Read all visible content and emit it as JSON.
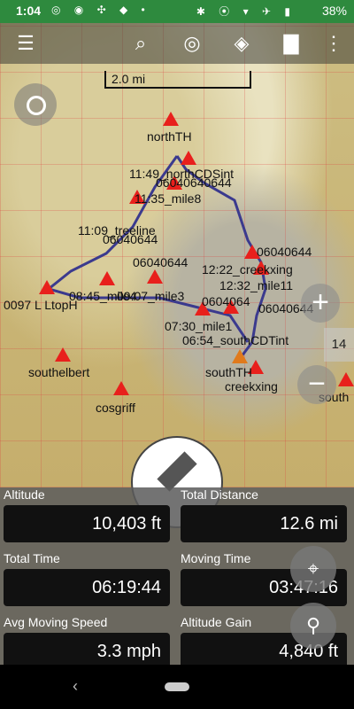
{
  "status": {
    "time": "1:04",
    "left_icons": "◎ ◉ ✣ ◆ •",
    "right_icons": "✱ ⦿ ▾ ✈ ▮",
    "battery": "38%"
  },
  "toolbar": {
    "menu": "☰",
    "search": "⌕",
    "locate": "◎",
    "layers": "◈",
    "folder": "▇",
    "more": "⋮"
  },
  "scale": {
    "label": "2.0 mi"
  },
  "map": {
    "labels": [
      "northTH",
      "11:49_northCDSint",
      "06040640644",
      "11:35_mile8",
      "11:09_treeline",
      "06040644",
      "06040644",
      "06040644",
      "12:22_creekxing",
      "12:32_mile11",
      "0604064",
      "08:45_mile4",
      "09:07_mile3",
      "06040644",
      "07:30_mile1",
      "06:54_southCDTint",
      "0097 L LtopH",
      "southelbert",
      "cosgriff",
      "southTH",
      "creekxing",
      "south"
    ],
    "zoom_in": "+",
    "zoom_out": "−",
    "zoom_level": "14"
  },
  "stats": [
    {
      "label": "Altitude",
      "value": "10,403 ft"
    },
    {
      "label": "Total Distance",
      "value": "12.6 mi"
    },
    {
      "label": "Total Time",
      "value": "06:19:44"
    },
    {
      "label": "Moving Time",
      "value": "03:47:16"
    },
    {
      "label": "Avg Moving Speed",
      "value": "3.3 mph"
    },
    {
      "label": "Altitude Gain",
      "value": "4,840 ft"
    }
  ],
  "fab": {
    "locate": "⌖",
    "pin": "⚲"
  },
  "nav": {
    "back": "‹"
  }
}
